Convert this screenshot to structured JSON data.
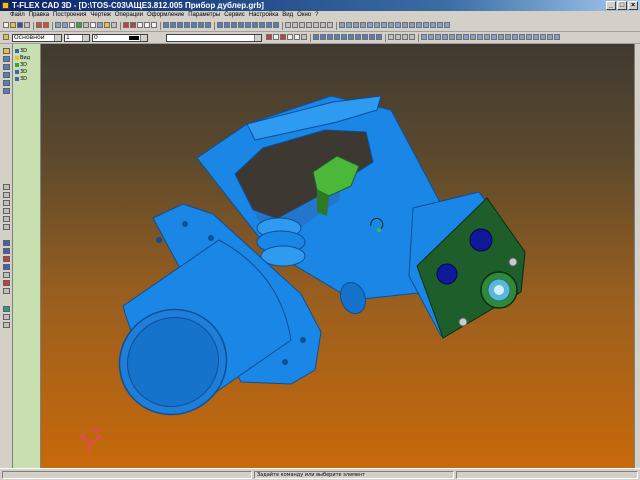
{
  "window": {
    "title": "T-FLEX CAD 3D - [D:\\TOS-C03\\АЩЕ3.812.005 Прибор дублер.grb]",
    "minimize_glyph": "_",
    "maximize_glyph": "□",
    "close_glyph": "×"
  },
  "menu": [
    "Файл",
    "Правка",
    "Построения",
    "Чертеж",
    "Операции",
    "Оформление",
    "Параметры",
    "Сервис",
    "Настройка",
    "Вид",
    "Окно",
    "?"
  ],
  "toolbar": {
    "layer_combo": "Основной",
    "size_value": "1",
    "color_value": "0",
    "style_combo": ""
  },
  "tree": {
    "items": [
      "3D",
      "Вид",
      "3D",
      "3D",
      "3D"
    ]
  },
  "status": {
    "message": "Задайте команду или выберите элемент"
  },
  "colors": {
    "model_blue": "#1a86e6",
    "board_green": "#1d5e2a",
    "accent_green": "#4cb83a",
    "viewport_top": "#3f3a31",
    "viewport_bottom": "#c8690a"
  }
}
